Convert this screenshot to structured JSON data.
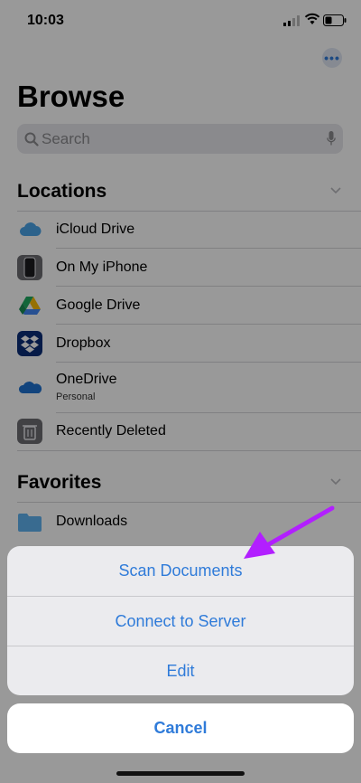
{
  "status_bar": {
    "time": "10:03"
  },
  "header": {
    "title": "Browse",
    "more_icon": "ellipsis-icon"
  },
  "search": {
    "placeholder": "Search",
    "value": ""
  },
  "locations": {
    "header": "Locations",
    "items": [
      {
        "label": "iCloud Drive",
        "icon": "icloud-icon"
      },
      {
        "label": "On My iPhone",
        "icon": "iphone-icon"
      },
      {
        "label": "Google Drive",
        "icon": "google-drive-icon"
      },
      {
        "label": "Dropbox",
        "icon": "dropbox-icon"
      },
      {
        "label": "OneDrive",
        "sublabel": "Personal",
        "icon": "onedrive-icon"
      },
      {
        "label": "Recently Deleted",
        "icon": "trash-icon"
      }
    ]
  },
  "favorites": {
    "header": "Favorites",
    "items": [
      {
        "label": "Downloads",
        "icon": "folder-icon"
      }
    ]
  },
  "action_sheet": {
    "items": [
      {
        "label": "Scan Documents"
      },
      {
        "label": "Connect to Server"
      },
      {
        "label": "Edit"
      }
    ],
    "cancel": "Cancel"
  },
  "colors": {
    "accent": "#2f7bd9",
    "annotation_arrow": "#b21fff"
  }
}
